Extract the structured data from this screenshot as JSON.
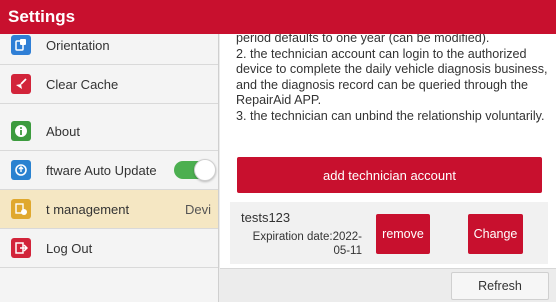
{
  "app": {
    "title": "Settings"
  },
  "sidebar": {
    "items": [
      {
        "label": "Orientation",
        "icon": "orientation-icon",
        "color": "#2f7fd6"
      },
      {
        "label": "Clear Cache",
        "icon": "broom-icon",
        "color": "#d2243a"
      },
      {
        "label": "About",
        "icon": "info-icon",
        "color": "#3c9b3e"
      },
      {
        "label": "ftware Auto Update",
        "icon": "update-icon",
        "color": "#2a82d0",
        "toggle_on": true
      },
      {
        "label": "t management",
        "trailing": "Devi",
        "icon": "user-management-icon",
        "color": "#e0a82e",
        "active": true
      },
      {
        "label": "Log Out",
        "icon": "logout-icon",
        "color": "#d2243a"
      }
    ]
  },
  "main": {
    "description": [
      "period defaults to one year (can be modified).",
      "2. the technician account can login to the authorized device to complete the daily vehicle diagnosis business, and the diagnosis record can be queried through the RepairAid APP.",
      "3. the technician can unbind the relationship voluntarily."
    ],
    "add_button": "add technician account",
    "account": {
      "name": "tests123",
      "expiration_label": "Expiration date:2022-",
      "expiration_rest": "05-11",
      "remove_label": "remove",
      "change_label": "Change"
    }
  },
  "footer": {
    "refresh_label": "Refresh"
  },
  "colors": {
    "brand_red": "#c8102e",
    "toggle_green": "#4caf50",
    "active_item": "#f5e7c3"
  }
}
